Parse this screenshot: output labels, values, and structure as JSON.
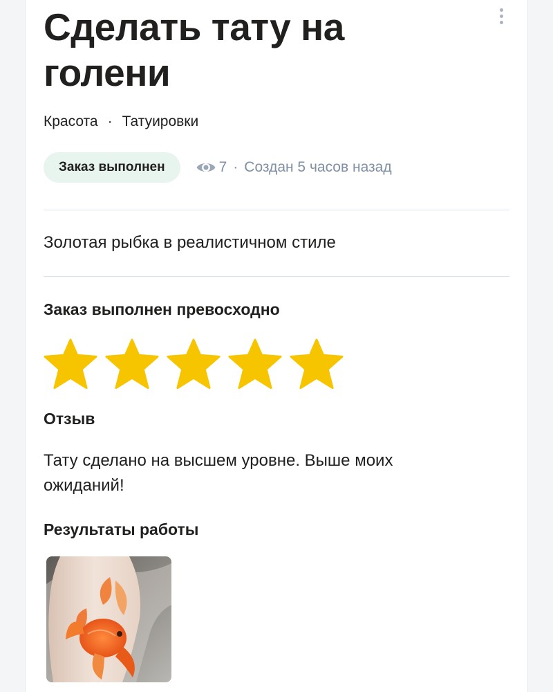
{
  "order": {
    "title": "Сделать тату на голени",
    "breadcrumb": {
      "category": "Красота",
      "separator": "·",
      "subcategory": "Татуировки"
    },
    "status": "Заказ выполнен",
    "views": "7",
    "meta_separator": "·",
    "created": "Создан 5 часов назад",
    "description": "Золотая рыбка в реалистичном стиле"
  },
  "rating": {
    "title": "Заказ выполнен превосходно",
    "stars": 5,
    "max_stars": 5,
    "star_color": "#f7c500"
  },
  "review": {
    "title": "Отзыв",
    "text": "Тату сделано на высшем уровне. Выше моих ожиданий!"
  },
  "results": {
    "title": "Результаты работы",
    "photos": [
      {
        "subject": "goldfish-tattoo"
      }
    ]
  },
  "icons": {
    "more": "more-vertical-icon",
    "views": "eye-icon",
    "star": "star-icon"
  },
  "colors": {
    "status_badge_bg": "#e8f5ee",
    "muted_text": "#7f8fa4",
    "divider": "#dde3ea"
  }
}
